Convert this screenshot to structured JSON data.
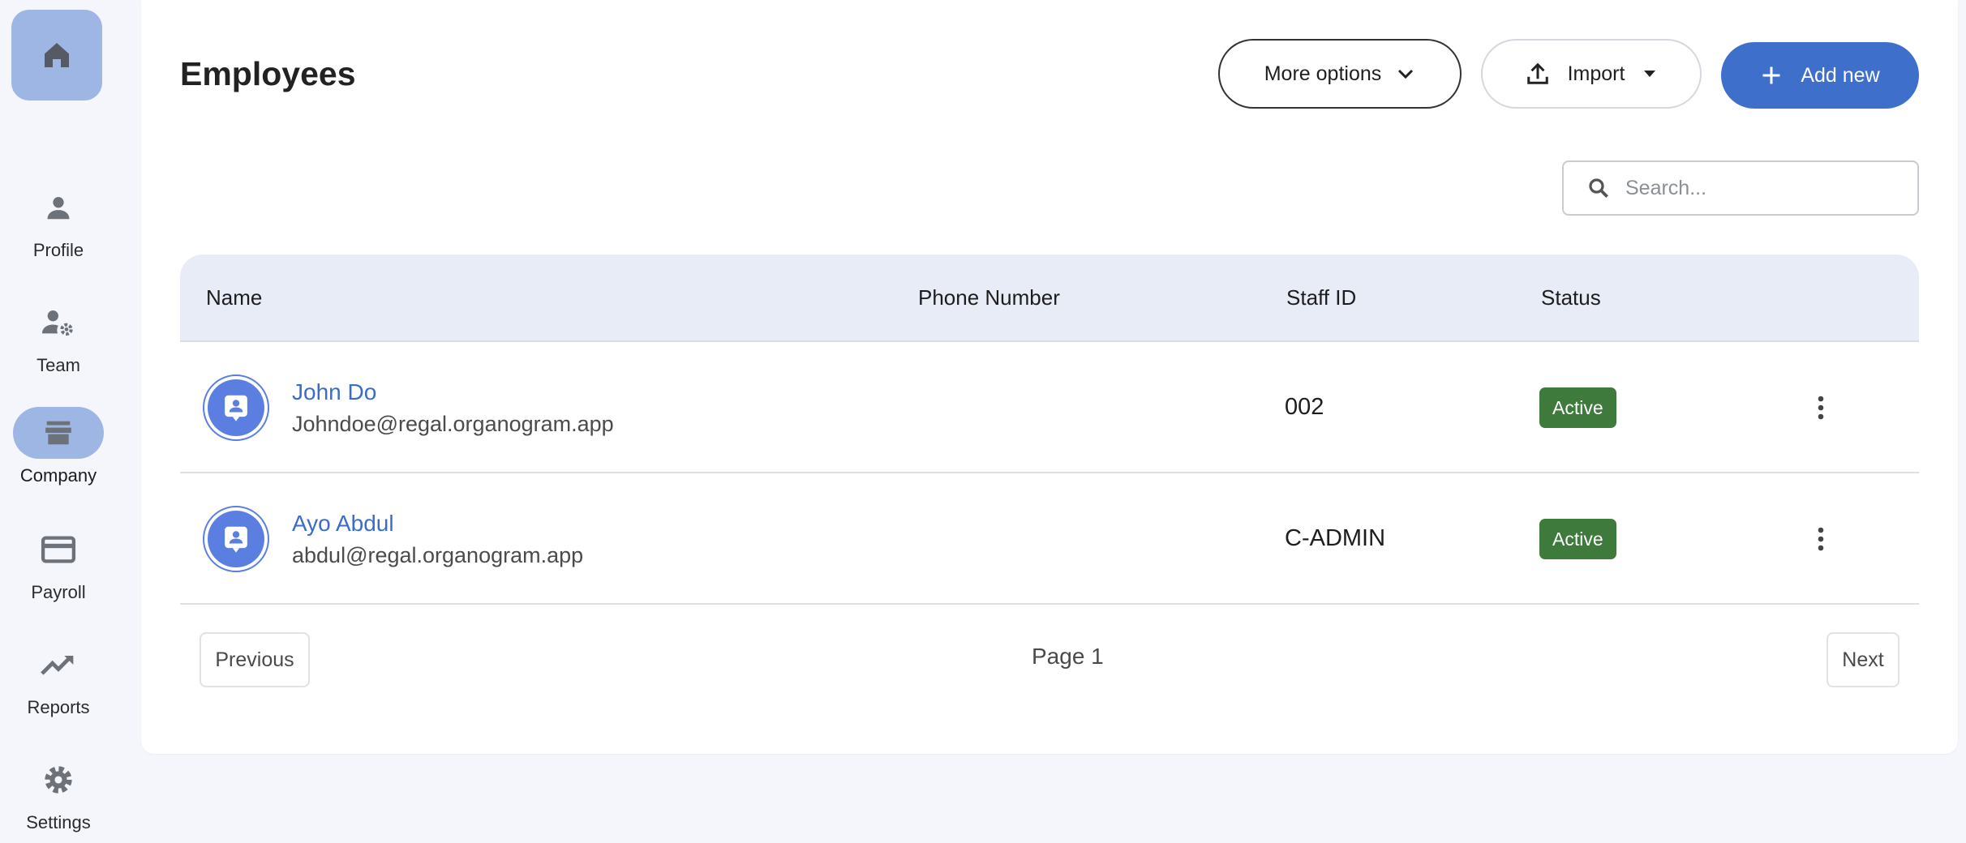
{
  "sidebar": {
    "home": {
      "icon": "home-icon"
    },
    "items": [
      {
        "label": "Profile",
        "icon": "person-icon",
        "active": false
      },
      {
        "label": "Team",
        "icon": "team-settings-icon",
        "active": false
      },
      {
        "label": "Company",
        "icon": "store-icon",
        "active": true
      },
      {
        "label": "Payroll",
        "icon": "credit-card-icon",
        "active": false
      },
      {
        "label": "Reports",
        "icon": "trending-up-icon",
        "active": false
      },
      {
        "label": "Settings",
        "icon": "gear-icon",
        "active": false
      }
    ]
  },
  "header": {
    "title": "Employees",
    "more_options_label": "More options",
    "import_label": "Import",
    "add_new_label": "Add new"
  },
  "search": {
    "placeholder": "Search...",
    "value": ""
  },
  "table": {
    "columns": [
      "Name",
      "Phone Number",
      "Staff ID",
      "Status"
    ],
    "rows": [
      {
        "name": "John Do",
        "email": "Johndoe@regal.organogram.app",
        "phone": "",
        "staff_id": "002",
        "status": "Active"
      },
      {
        "name": "Ayo Abdul",
        "email": "abdul@regal.organogram.app",
        "phone": "",
        "staff_id": "C-ADMIN",
        "status": "Active"
      }
    ]
  },
  "pagination": {
    "previous_label": "Previous",
    "page_label": "Page 1",
    "next_label": "Next"
  },
  "colors": {
    "accent": "#3d6fcb",
    "active_nav": "#9db6e4",
    "status_active": "#3e7a3c",
    "header_row": "#e7ecf7"
  }
}
